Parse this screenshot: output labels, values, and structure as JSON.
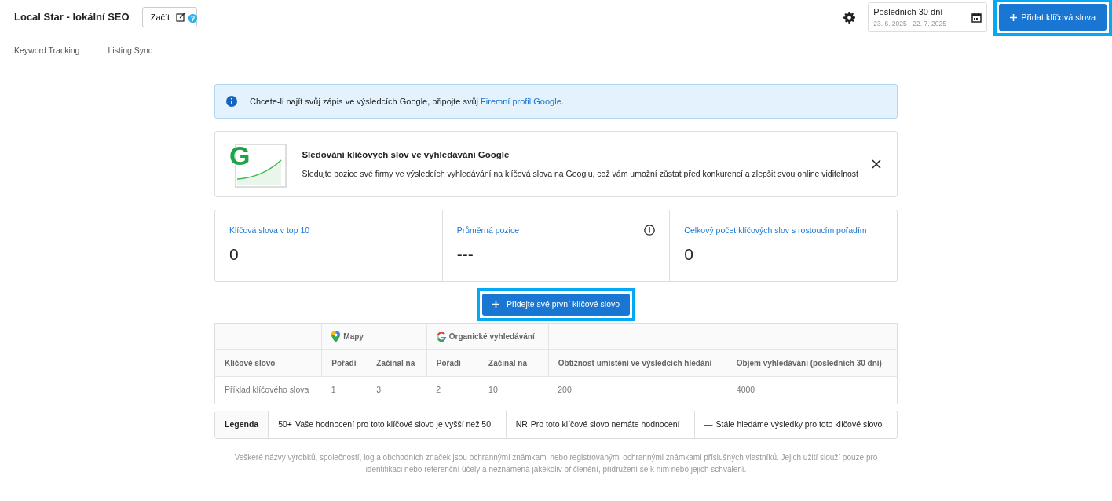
{
  "header": {
    "title": "Local Star - lokální SEO",
    "start_button": "Začít",
    "date_range": {
      "label": "Posledních 30 dní",
      "range": "23. 6. 2025 - 22. 7. 2025"
    },
    "add_button": {
      "label": "Přidat klíčová slova",
      "highlighted": true
    }
  },
  "tabs": [
    {
      "label": "Keyword Tracking",
      "selected": false
    },
    {
      "label": "Listing Sync",
      "selected": false
    }
  ],
  "alert": {
    "text": "Chcete-li najít svůj zápis ve výsledcích Google, připojte svůj",
    "link": "Firemní profil Google."
  },
  "promo": {
    "logo_letter": "G",
    "title": "Sledování klíčových slov ve vyhledávání Google",
    "text": "Sledujte pozice své firmy ve výsledcích vyhledávání na klíčová slova na Googlu, což vám umožní zůstat před konkurencí a zlepšit svou online viditelnost"
  },
  "stats": [
    {
      "label": "Klíčová slova v top 10",
      "value": "0",
      "info": false
    },
    {
      "label": "Průměrná pozice",
      "value": "---",
      "info": true
    },
    {
      "label": "Celkový počet klíčových slov s rostoucím pořadím",
      "value": "0",
      "info": false
    }
  ],
  "first_keyword_button": {
    "label": "Přidejte své první klíčové slovo",
    "highlighted": true
  },
  "table": {
    "groups": [
      {
        "kind": "keyword"
      },
      {
        "label": "Mapy",
        "kind": "maps"
      },
      {
        "label": "Organické vyhledávání",
        "kind": "google"
      },
      {
        "kind": "metrics"
      }
    ],
    "columns": [
      "Klíčové slovo",
      "Pořadí",
      "Začínal na",
      "Pořadí",
      "Začínal na",
      "Obtížnost umístění ve výsledcích hledání",
      "Objem vyhledávání (posledních 30 dní)"
    ],
    "rows": [
      [
        "Příklad klíčového slova",
        "1",
        "3",
        "2",
        "10",
        "200",
        "4000"
      ]
    ]
  },
  "legend": {
    "title": "Legenda",
    "items": [
      {
        "symbol": "50+",
        "text": "Vaše hodnocení pro toto klíčové slovo je vyšší než 50"
      },
      {
        "symbol": "NR",
        "text": "Pro toto klíčové slovo nemáte hodnocení"
      },
      {
        "symbol": "—",
        "text": "Stále hledáme výsledky pro toto klíčové slovo"
      }
    ]
  },
  "footer": "Veškeré názvy výrobků, společností, log a obchodních značek jsou ochrannými známkami nebo registrovanými ochrannými známkami příslušných vlastníků. Jejich užití slouží pouze pro identifikaci nebo referenční účely a neznamená jakékoliv přičlenění, přidružení se k nim nebo jejich schválení."
}
